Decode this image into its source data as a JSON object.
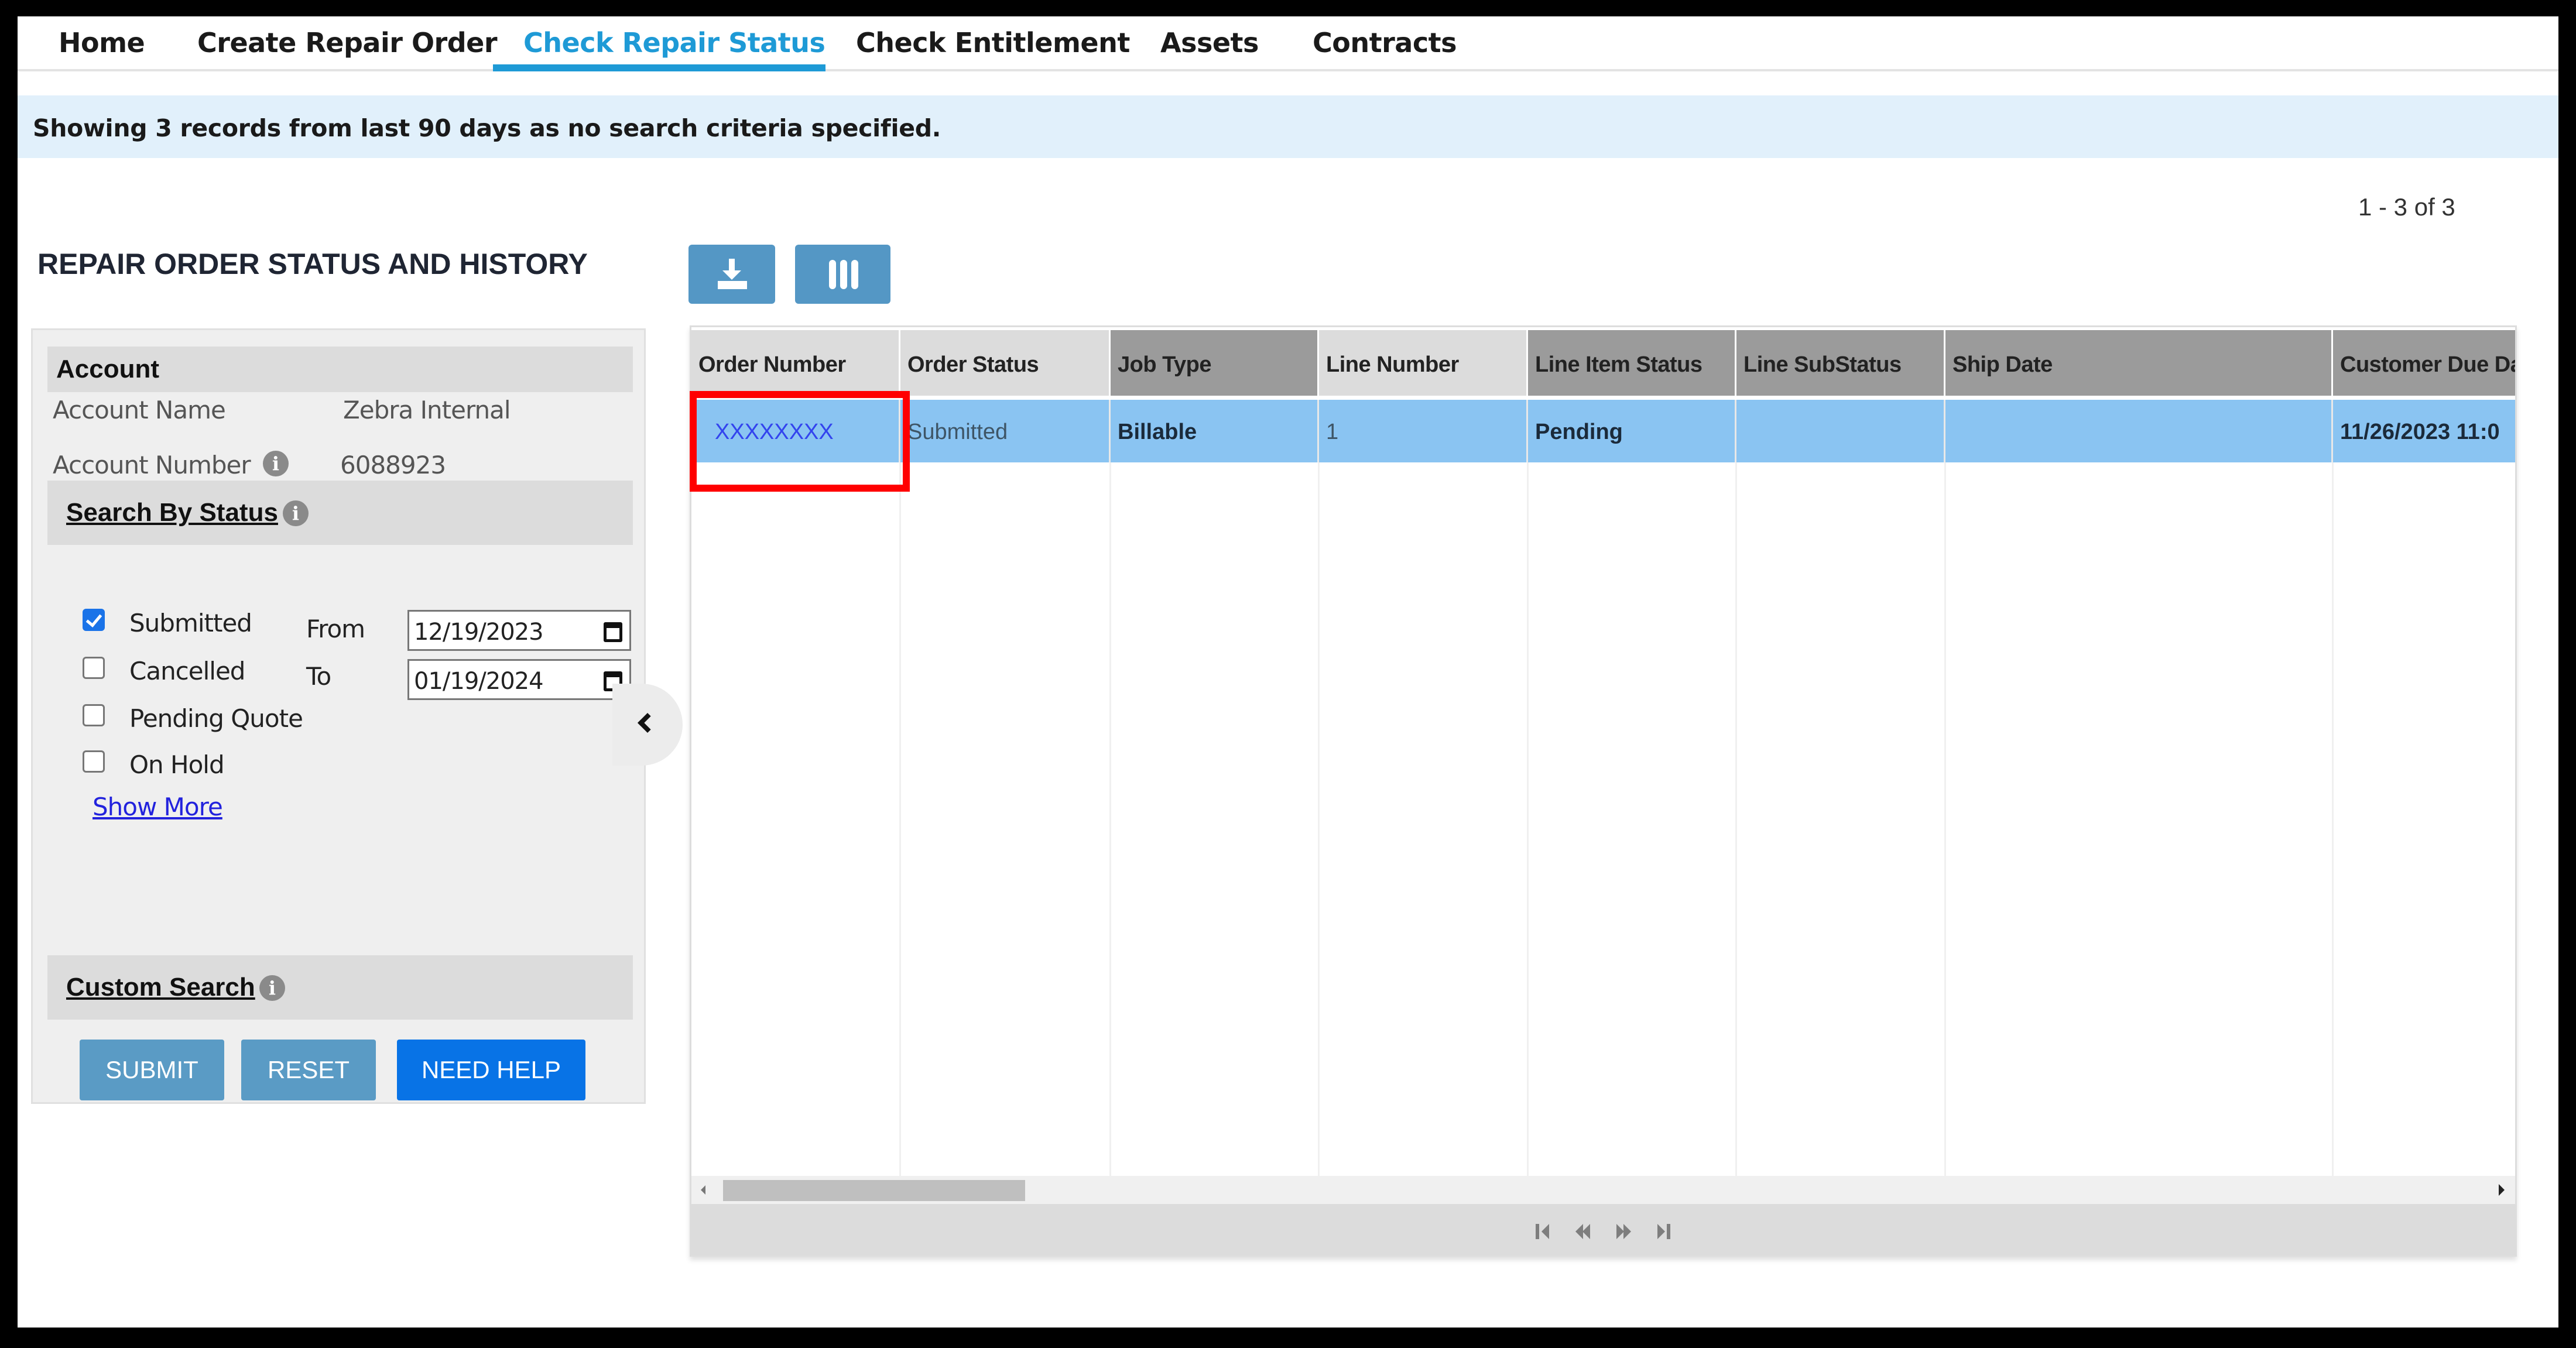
{
  "nav": {
    "items": [
      {
        "label": "Home",
        "active": false
      },
      {
        "label": "Create Repair Order",
        "active": false
      },
      {
        "label": "Check Repair Status",
        "active": true
      },
      {
        "label": "Check Entitlement",
        "active": false
      },
      {
        "label": "Assets",
        "active": false
      },
      {
        "label": "Contracts",
        "active": false
      }
    ]
  },
  "banner": {
    "text": "Showing 3 records from last 90 days as no search criteria specified."
  },
  "page_title": "REPAIR ORDER STATUS AND HISTORY",
  "record_count": "1 - 3 of 3",
  "account": {
    "section_title": "Account",
    "name_label": "Account Name",
    "name_value": "Zebra Internal",
    "number_label": "Account Number",
    "number_value": "6088923",
    "info_icon": "i"
  },
  "search_by_status": {
    "title": "Search By Status",
    "statuses": [
      {
        "label": "Submitted",
        "checked": true
      },
      {
        "label": "Cancelled",
        "checked": false
      },
      {
        "label": "Pending Quote",
        "checked": false
      },
      {
        "label": "On Hold",
        "checked": false
      }
    ],
    "from_label": "From",
    "from_value": "12/19/2023",
    "to_label": "To",
    "to_value": "01/19/2024",
    "show_more": "Show More"
  },
  "custom_search": {
    "title": "Custom Search"
  },
  "buttons": {
    "submit": "SUBMIT",
    "reset": "RESET",
    "need_help": "NEED HELP"
  },
  "toolbar": {
    "download_icon": "download-icon",
    "columns_icon": "columns-icon"
  },
  "grid": {
    "columns": [
      "Order Number",
      "Order Status",
      "Job Type",
      "Line Number",
      "Line Item Status",
      "Line SubStatus",
      "Ship Date",
      "Customer Due Da"
    ],
    "rows": [
      {
        "order_number": "XXXXXXXX",
        "order_status": "Submitted",
        "job_type": "Billable",
        "line_number": "1",
        "line_item_status": "Pending",
        "line_substatus": "",
        "ship_date": "",
        "customer_due_date": "11/26/2023 11:0"
      }
    ],
    "pager": [
      "first-page",
      "previous-page",
      "next-page",
      "last-page"
    ]
  },
  "colors": {
    "accent": "#1e9ad6",
    "banner_bg": "#e1f0fb",
    "selected_row": "#8ac4f2",
    "highlight": "#ff0000",
    "primary_button": "#0873e6",
    "secondary_button": "#5a9bc5"
  }
}
